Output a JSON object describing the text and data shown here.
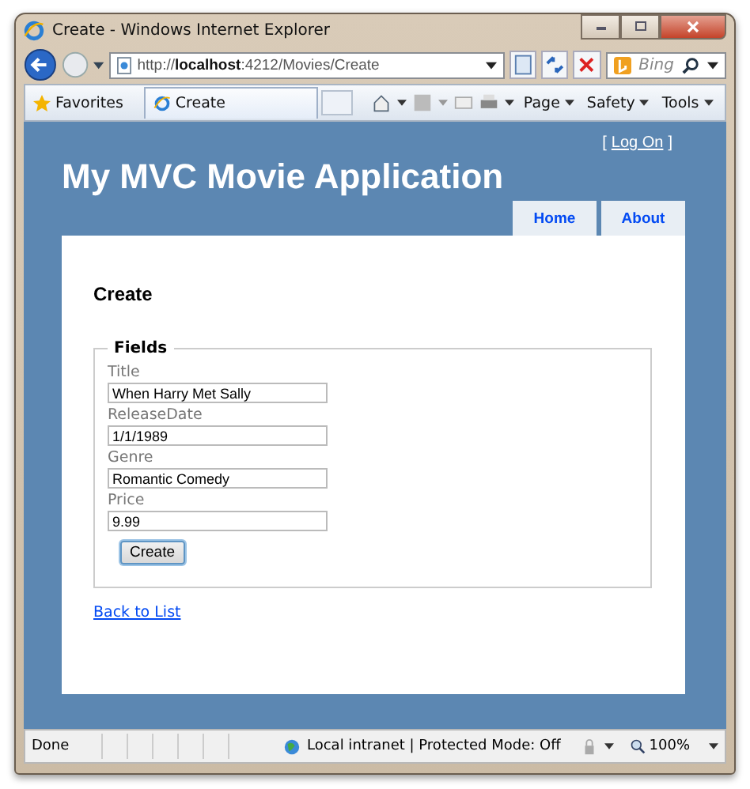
{
  "window": {
    "title": "Create - Windows Internet Explorer"
  },
  "address_bar": {
    "url_prefix": "http://",
    "url_host": "localhost",
    "url_rest": ":4212/Movies/Create",
    "search_placeholder": "Bing"
  },
  "favorites_bar": {
    "favorites": "Favorites",
    "tab": "Create",
    "commands": [
      "Page",
      "Safety",
      "Tools"
    ]
  },
  "site": {
    "title": "My MVC Movie Application",
    "logon_open": "[",
    "logon_link": "Log On",
    "logon_close": "]",
    "menu": [
      "Home",
      "About"
    ],
    "heading": "Create",
    "legend": "Fields",
    "fields": [
      {
        "label": "Title",
        "value": "When Harry Met Sally"
      },
      {
        "label": "ReleaseDate",
        "value": "1/1/1989"
      },
      {
        "label": "Genre",
        "value": "Romantic Comedy"
      },
      {
        "label": "Price",
        "value": "9.99"
      }
    ],
    "button": "Create",
    "back_link": "Back to List"
  },
  "status_bar": {
    "text": "Done",
    "zone": "Local intranet | Protected Mode: Off",
    "zoom": "100%"
  }
}
